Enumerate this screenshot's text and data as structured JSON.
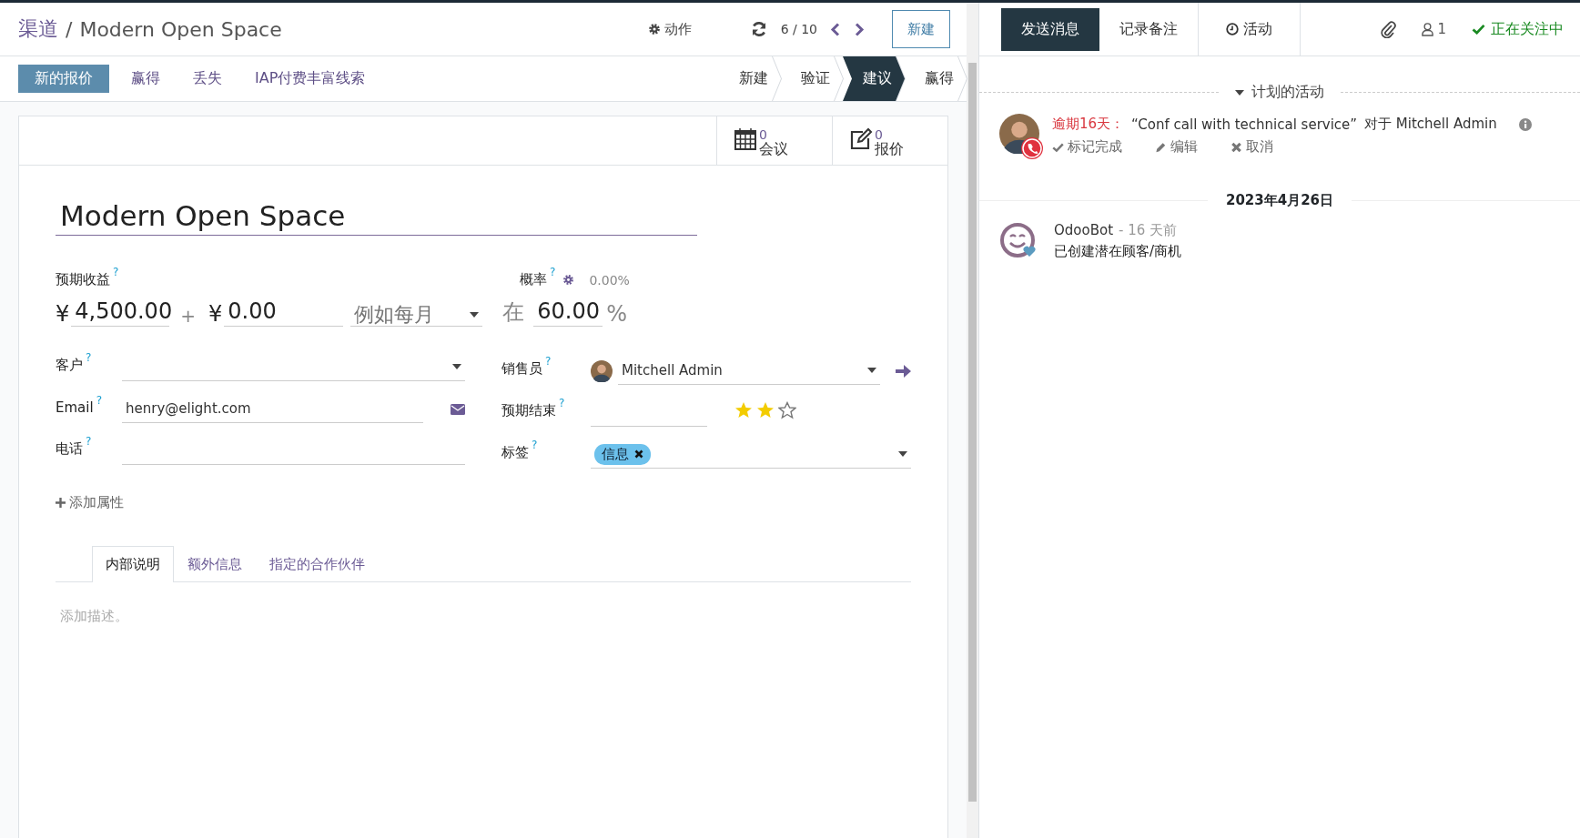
{
  "breadcrumb": {
    "parent": "渠道",
    "separator": "/",
    "current": "Modern Open Space"
  },
  "control_panel": {
    "action": "动作",
    "pager": "6 / 10",
    "new_button": "新建"
  },
  "header_buttons": [
    {
      "label": "新的报价",
      "primary": true
    },
    {
      "label": "赢得",
      "primary": false
    },
    {
      "label": "丢失",
      "primary": false
    },
    {
      "label": "IAP付费丰富线索",
      "primary": false
    }
  ],
  "stages": [
    {
      "label": "新建",
      "selected": false
    },
    {
      "label": "验证",
      "selected": false
    },
    {
      "label": "建议",
      "selected": true
    },
    {
      "label": "赢得",
      "selected": false
    }
  ],
  "smart_buttons": [
    {
      "kind": "calendar",
      "value": "0",
      "label": "会议"
    },
    {
      "kind": "edit",
      "value": "0",
      "label": "报价"
    }
  ],
  "title": "Modern Open Space",
  "revenue": {
    "label": "预期收益",
    "help": "?",
    "currency": "¥",
    "amount": "4,500.00",
    "plus": "+",
    "currency_2": "¥",
    "recurring": "0.00",
    "plan_placeholder": "例如每月",
    "at": "在",
    "probability": "60.00",
    "percent": "%"
  },
  "probability": {
    "label": "概率",
    "help": "?",
    "value": "0.00%"
  },
  "left_fields": [
    {
      "label": "客户",
      "help": "?",
      "kind": "select"
    },
    {
      "label": "Email",
      "help": "?",
      "kind": "email",
      "value": "henry@elight.com"
    },
    {
      "label": "电话",
      "help": "?",
      "kind": "text"
    }
  ],
  "right_fields": [
    {
      "label": "销售员",
      "help": "?",
      "kind": "user",
      "value": "Mitchell Admin"
    },
    {
      "label": "预期结束",
      "help": "?",
      "kind": "date",
      "stars": 2
    },
    {
      "label": "标签",
      "help": "?",
      "kind": "tags",
      "tags": [
        {
          "label": "信息",
          "color": "#6cc1ec"
        }
      ]
    }
  ],
  "add_property": "添加属性",
  "notebook": {
    "tabs": [
      {
        "label": "内部说明",
        "selected": true
      },
      {
        "label": "额外信息",
        "selected": false
      },
      {
        "label": "指定的合作伙伴",
        "selected": false
      }
    ],
    "placeholder": "添加描述。"
  },
  "chatter": {
    "buttons": [
      {
        "label": "发送消息",
        "selected": true,
        "kind": "plain"
      },
      {
        "label": "记录备注",
        "selected": false,
        "kind": "plain"
      },
      {
        "label": "活动",
        "selected": false,
        "kind": "clock"
      }
    ],
    "followers": "1",
    "following": "正在关注中",
    "activities": {
      "title": "计划的活动",
      "expanded": true,
      "items": [
        {
          "overdue": "逾期16天：",
          "summary": "“Conf call with technical service”",
          "assignee": "对于 Mitchell Admin",
          "actions": [
            {
              "kind": "done",
              "label": "标记完成"
            },
            {
              "kind": "edit",
              "label": "编辑"
            },
            {
              "kind": "cancel",
              "label": "取消"
            }
          ]
        }
      ]
    },
    "date": "2023年4月26日",
    "messages": [
      {
        "author": "OdooBot",
        "time": "- 16 天前",
        "body": "已创建潜在顾客/商机"
      }
    ]
  }
}
